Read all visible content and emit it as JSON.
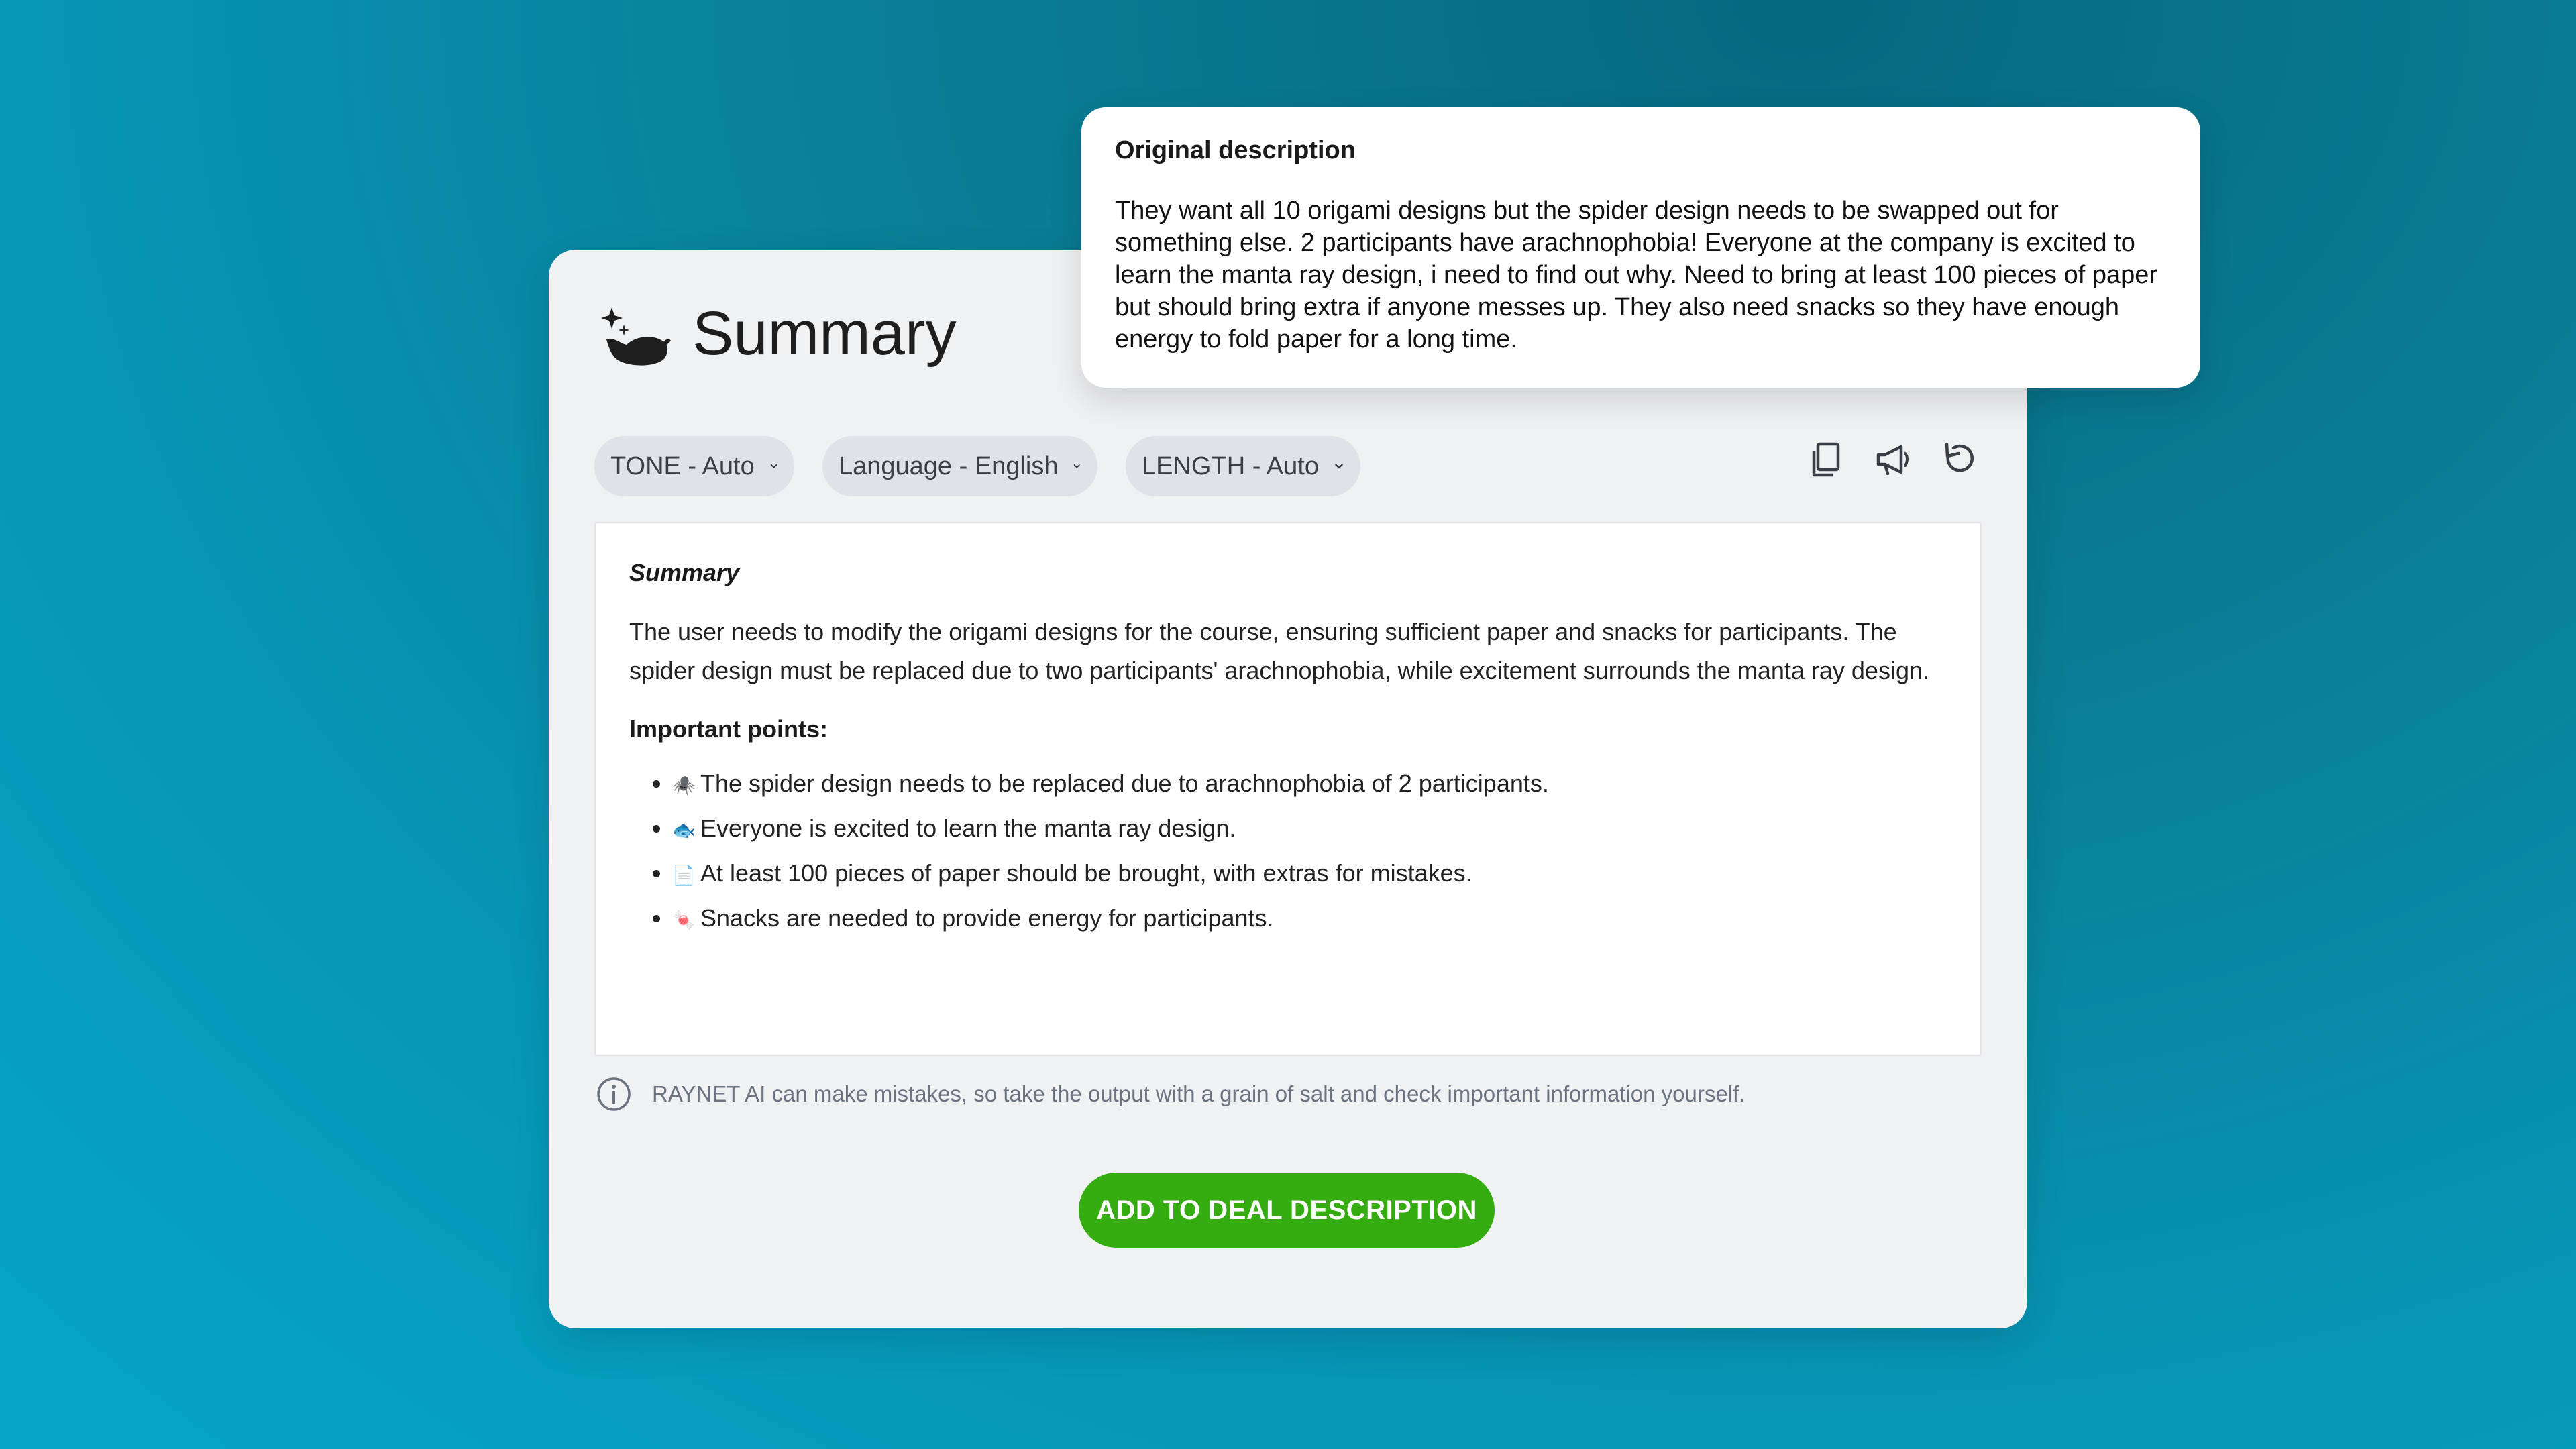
{
  "panel": {
    "title": "Summary",
    "icon": "sparkle-whale-icon"
  },
  "toolbar": {
    "tone_label": "TONE - Auto",
    "language_label": "Language - English",
    "length_label": "LENGTH - Auto",
    "icons": [
      "copy-icon",
      "megaphone-icon",
      "refresh-icon"
    ]
  },
  "content": {
    "title": "Summary",
    "body": "The user needs to modify the origami designs for the course, ensuring sufficient paper and snacks for participants. The spider design must be replaced due to two participants' arachnophobia, while excitement surrounds the manta ray design.",
    "points_title": "Important points:",
    "points": [
      {
        "emoji": "🕷️",
        "text": "The spider design needs to be replaced due to arachnophobia of 2 participants."
      },
      {
        "emoji": "🐟",
        "text": "Everyone is excited to learn the manta ray design."
      },
      {
        "emoji": "📄",
        "text": "At least 100 pieces of paper should be brought, with extras for mistakes."
      },
      {
        "emoji": "🍬",
        "text": "Snacks are needed to provide energy for participants."
      }
    ]
  },
  "disclaimer": "RAYNET AI can make mistakes, so take the output with a grain of salt and check important information yourself.",
  "cta_label": "ADD TO DEAL DESCRIPTION",
  "original": {
    "title": "Original description",
    "text": "They want all 10 origami designs but the spider design needs to be swapped out for something else. 2 participants have arachnophobia! Everyone at the company is excited to learn the manta ray design, i need to find out why. Need to bring at least 100 pieces of paper but should bring extra if anyone messes up. They also need snacks so they have enough energy to fold paper for a long time."
  },
  "colors": {
    "accent_green": "#35ac0f",
    "background_teal": "#0696b6",
    "panel_bg": "#f0f1f3",
    "pill_bg": "#dfe2e7"
  }
}
